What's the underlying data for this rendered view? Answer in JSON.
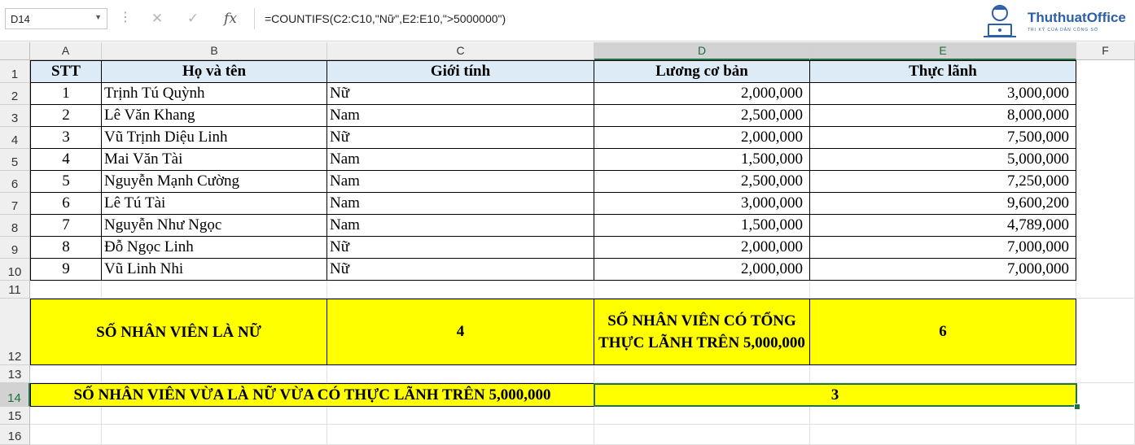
{
  "formula_bar": {
    "name_box": "D14",
    "formula": "=COUNTIFS(C2:C10,\"Nữ\",E2:E10,\">5000000\")"
  },
  "logo": {
    "brand": "ThuthuatOffice",
    "tagline": "TRI KỶ CỦA DÂN CÔNG SỞ"
  },
  "columns": [
    "A",
    "B",
    "C",
    "D",
    "E",
    "F"
  ],
  "rows": [
    "1",
    "2",
    "3",
    "4",
    "5",
    "6",
    "7",
    "8",
    "9",
    "10",
    "11",
    "12",
    "13",
    "14",
    "15",
    "16"
  ],
  "table": {
    "headers": [
      "STT",
      "Họ và tên",
      "Giới tính",
      "Lương cơ bản",
      "Thực lãnh"
    ],
    "records": [
      {
        "stt": "1",
        "name": "Trịnh Tú Quỳnh",
        "gender": "Nữ",
        "salary": "2,000,000",
        "net": "3,000,000"
      },
      {
        "stt": "2",
        "name": "Lê Văn Khang",
        "gender": "Nam",
        "salary": "2,500,000",
        "net": "8,000,000"
      },
      {
        "stt": "3",
        "name": "Vũ Trịnh Diệu Linh",
        "gender": "Nữ",
        "salary": "2,000,000",
        "net": "7,500,000"
      },
      {
        "stt": "4",
        "name": "Mai Văn Tài",
        "gender": "Nam",
        "salary": "1,500,000",
        "net": "5,000,000"
      },
      {
        "stt": "5",
        "name": "Nguyễn Mạnh Cường",
        "gender": "Nam",
        "salary": "2,500,000",
        "net": "7,250,000"
      },
      {
        "stt": "6",
        "name": "Lê Tú Tài",
        "gender": "Nam",
        "salary": "3,000,000",
        "net": "9,600,200"
      },
      {
        "stt": "7",
        "name": "Nguyễn Như Ngọc",
        "gender": "Nam",
        "salary": "1,500,000",
        "net": "4,789,000"
      },
      {
        "stt": "8",
        "name": "Đỗ Ngọc Linh",
        "gender": "Nữ",
        "salary": "2,000,000",
        "net": "7,000,000"
      },
      {
        "stt": "9",
        "name": "Vũ Linh Nhi",
        "gender": "Nữ",
        "salary": "2,000,000",
        "net": "7,000,000"
      }
    ]
  },
  "summary": {
    "female_label": "SỐ NHÂN VIÊN LÀ NỮ",
    "female_count": "4",
    "over5m_label": "SỐ NHÂN VIÊN CÓ TỔNG THỰC LÃNH TRÊN 5,000,000",
    "over5m_count": "6",
    "both_label": "SỐ NHÂN VIÊN VỪA LÀ NỮ VỪA CÓ THỰC LÃNH TRÊN 5,000,000",
    "both_count": "3"
  },
  "colors": {
    "header_fill": "#ddebf7",
    "highlight": "#ffff00",
    "selection": "#217346"
  }
}
